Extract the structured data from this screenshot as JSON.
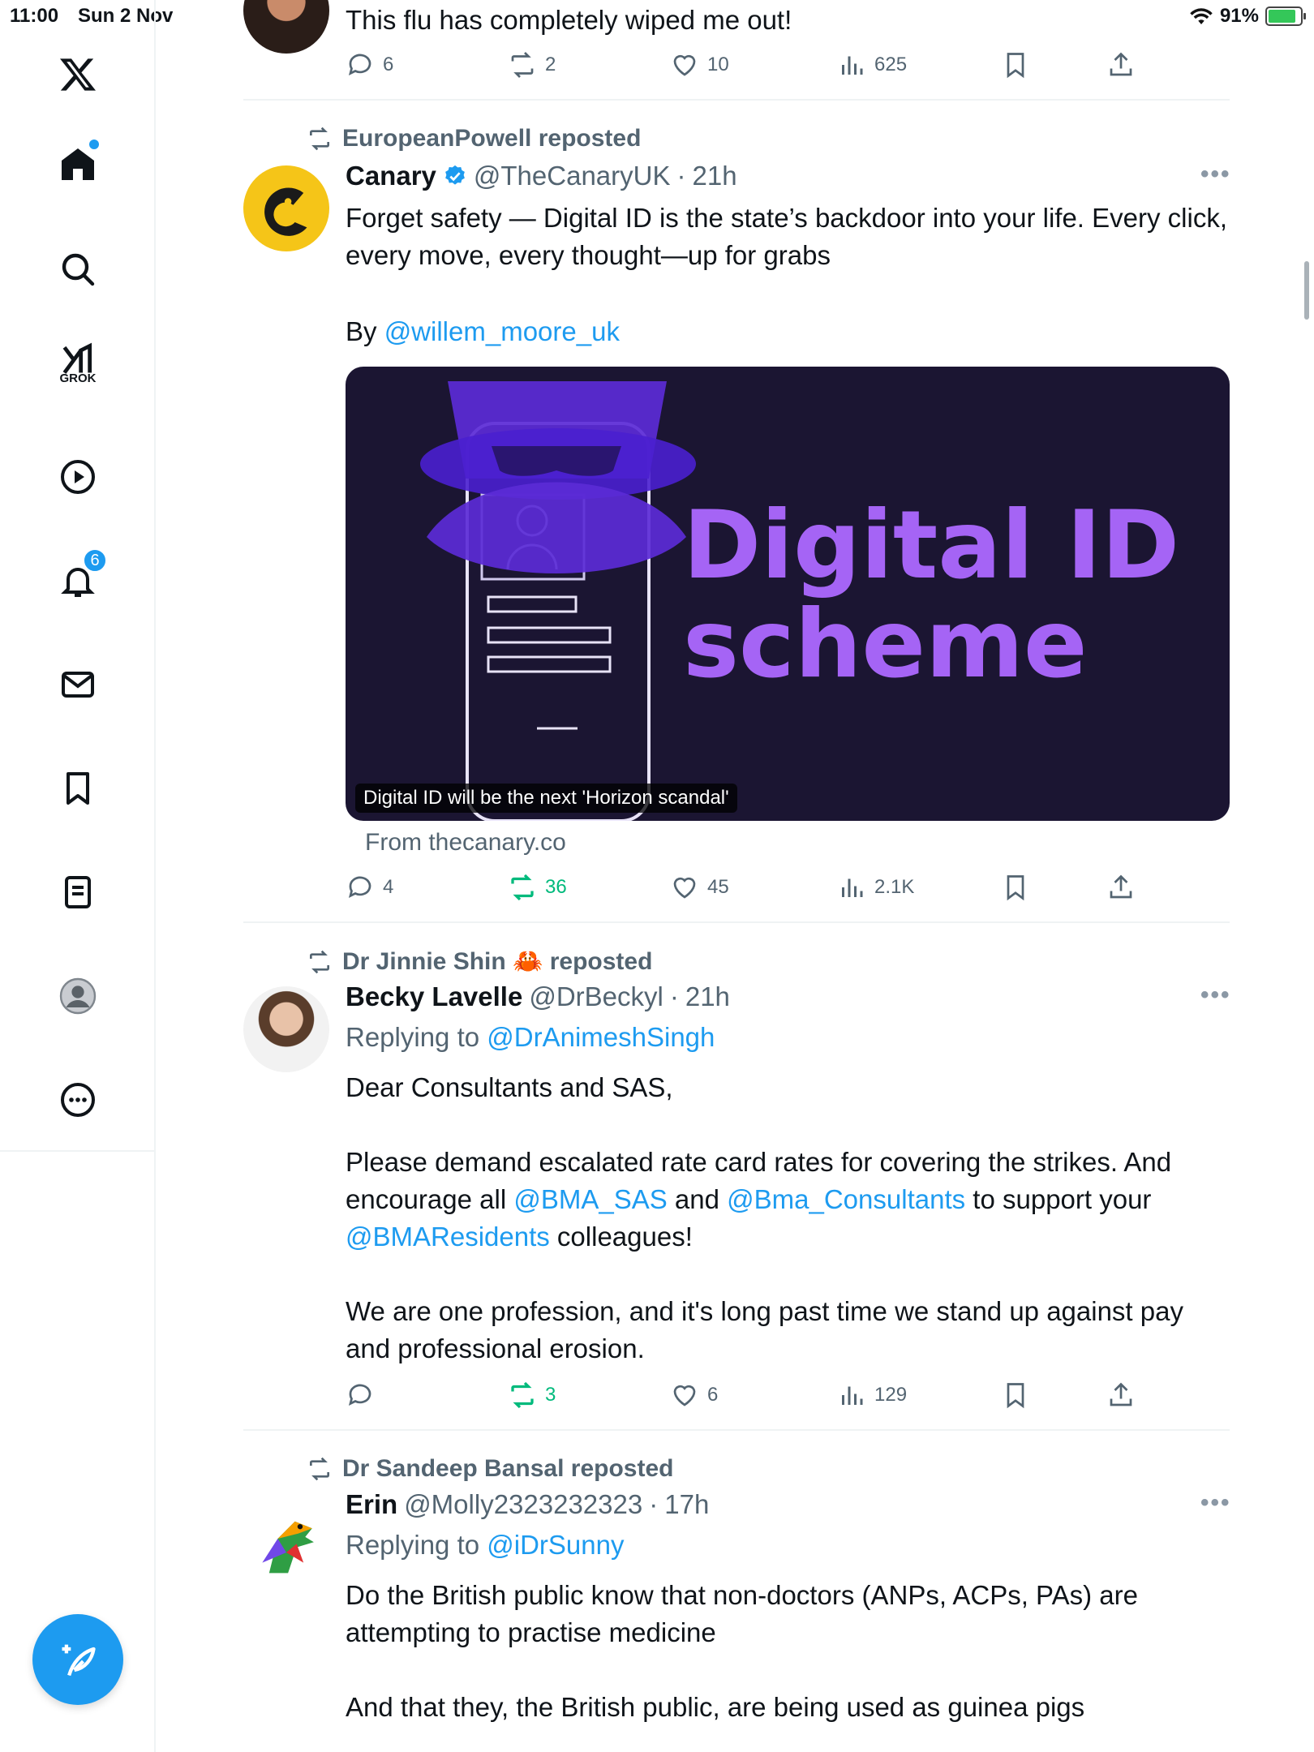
{
  "status": {
    "time": "11:00",
    "date": "Sun 2 Nov",
    "battery": "91%"
  },
  "sidebar": {
    "grok_label": "GROK",
    "notifications_count": "6"
  },
  "tweets": [
    {
      "text": "This flu has completely wiped me out!",
      "actions": {
        "reply": "6",
        "repost": "2",
        "like": "10",
        "views": "625"
      }
    },
    {
      "repost_by": "EuropeanPowell reposted",
      "name": "Canary",
      "handle": "@TheCanaryUK",
      "sep": "·",
      "time": "21h",
      "text_line1": "Forget safety — Digital ID is the state’s backdoor into your life. Every click, every move, every thought—up for grabs",
      "by_prefix": "By ",
      "by_link": "@willem_moore_uk",
      "card": {
        "title_line1": "Digital ID",
        "title_line2": "scheme",
        "caption": "Digital ID will be the next 'Horizon scandal'",
        "source": "From thecanary.co"
      },
      "actions": {
        "reply": "4",
        "repost": "36",
        "like": "45",
        "views": "2.1K"
      }
    },
    {
      "repost_by": "Dr Jinnie Shin 🦀 reposted",
      "name": "Becky Lavelle",
      "handle": "@DrBeckyl",
      "sep": "·",
      "time": "21h",
      "replying_prefix": "Replying to ",
      "replying_to": "@DrAnimeshSingh",
      "p1": "Dear Consultants and SAS,",
      "p2a": "Please demand escalated rate card rates for covering the strikes. And encourage all ",
      "p2_link1": "@BMA_SAS",
      "p2b": " and ",
      "p2_link2": "@Bma_Consultants",
      "p2c": " to support your ",
      "p2_link3": "@BMAResidents",
      "p2d": " colleagues!",
      "p3": "We are one profession, and it's long past time we stand up against pay and professional erosion.",
      "actions": {
        "reply": "",
        "repost": "3",
        "like": "6",
        "views": "129"
      }
    },
    {
      "repost_by": "Dr Sandeep Bansal reposted",
      "name": "Erin",
      "handle": "@Molly2323232323",
      "sep": "·",
      "time": "17h",
      "replying_prefix": "Replying to ",
      "replying_to": "@iDrSunny",
      "p1": "Do the British public know that non-doctors (ANPs, ACPs, PAs) are attempting to practise medicine",
      "p2": "And that they, the British public, are being used as guinea pigs"
    }
  ],
  "colors": {
    "accent": "#1d9bf0",
    "repost_green": "#00ba7c",
    "card_purple": "#a564f5"
  }
}
